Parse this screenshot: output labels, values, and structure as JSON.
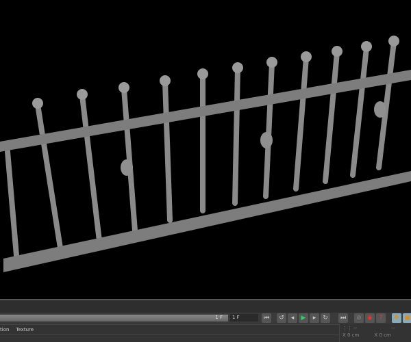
{
  "viewport": {
    "label": "3D viewport - iron fence"
  },
  "timeline": {
    "slider_value": "1 F",
    "current_frame": "1 F"
  },
  "transport": {
    "icons": [
      "go-start-icon",
      "prev-key-icon",
      "prev-frame-icon",
      "play-icon",
      "next-frame-icon",
      "next-key-icon",
      "go-end-icon",
      "record-icon",
      "autokey-icon",
      "help-icon",
      "move-icon",
      "scale-icon"
    ]
  },
  "menu": {
    "items": [
      "tion",
      "Texture"
    ]
  },
  "coords": {
    "header_a": "--",
    "header_b": "--",
    "x_label": "X",
    "x_value": "0 cm",
    "x2_label": "X",
    "x2_value": "0 cm"
  }
}
